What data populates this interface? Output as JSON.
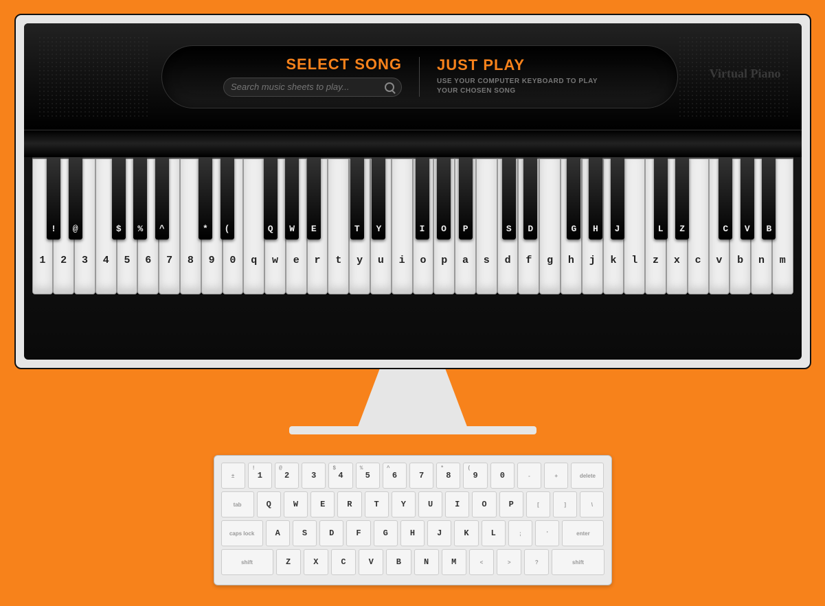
{
  "header": {
    "select_song": "SELECT SONG",
    "search_placeholder": "Search music sheets to play...",
    "just_play": "JUST PLAY",
    "sub1": "USE YOUR COMPUTER KEYBOARD TO PLAY",
    "sub2": "YOUR CHOSEN SONG",
    "logo": "Virtual Piano"
  },
  "white_keys": [
    "1",
    "2",
    "3",
    "4",
    "5",
    "6",
    "7",
    "8",
    "9",
    "0",
    "q",
    "w",
    "e",
    "r",
    "t",
    "y",
    "u",
    "i",
    "o",
    "p",
    "a",
    "s",
    "d",
    "f",
    "g",
    "h",
    "j",
    "k",
    "l",
    "z",
    "x",
    "c",
    "v",
    "b",
    "n",
    "m"
  ],
  "black_keys": [
    {
      "pos": 0,
      "label": "!"
    },
    {
      "pos": 1,
      "label": "@"
    },
    {
      "pos": 3,
      "label": "$"
    },
    {
      "pos": 4,
      "label": "%"
    },
    {
      "pos": 5,
      "label": "^"
    },
    {
      "pos": 7,
      "label": "*"
    },
    {
      "pos": 8,
      "label": "("
    },
    {
      "pos": 10,
      "label": "Q"
    },
    {
      "pos": 11,
      "label": "W"
    },
    {
      "pos": 12,
      "label": "E"
    },
    {
      "pos": 14,
      "label": "T"
    },
    {
      "pos": 15,
      "label": "Y"
    },
    {
      "pos": 17,
      "label": "I"
    },
    {
      "pos": 18,
      "label": "O"
    },
    {
      "pos": 19,
      "label": "P"
    },
    {
      "pos": 21,
      "label": "S"
    },
    {
      "pos": 22,
      "label": "D"
    },
    {
      "pos": 24,
      "label": "G"
    },
    {
      "pos": 25,
      "label": "H"
    },
    {
      "pos": 26,
      "label": "J"
    },
    {
      "pos": 28,
      "label": "L"
    },
    {
      "pos": 29,
      "label": "Z"
    },
    {
      "pos": 31,
      "label": "C"
    },
    {
      "pos": 32,
      "label": "V"
    },
    {
      "pos": 33,
      "label": "B"
    }
  ],
  "kbd": {
    "r1": [
      {
        "l": "±",
        "w": "kw1",
        "sm": 1
      },
      {
        "l": "1",
        "s": "!",
        "w": "kw1"
      },
      {
        "l": "2",
        "s": "@",
        "w": "kw1"
      },
      {
        "l": "3",
        "s": "",
        "w": "kw1"
      },
      {
        "l": "4",
        "s": "$",
        "w": "kw1"
      },
      {
        "l": "5",
        "s": "%",
        "w": "kw1"
      },
      {
        "l": "6",
        "s": "^",
        "w": "kw1"
      },
      {
        "l": "7",
        "s": "",
        "w": "kw1"
      },
      {
        "l": "8",
        "s": "*",
        "w": "kw1"
      },
      {
        "l": "9",
        "s": "(",
        "w": "kw1"
      },
      {
        "l": "0",
        "s": "",
        "w": "kw1"
      },
      {
        "l": "-",
        "w": "kw1",
        "sm": 1
      },
      {
        "l": "+",
        "w": "kw1",
        "sm": 1
      },
      {
        "l": "delete",
        "w": "kw15",
        "sm": 1
      }
    ],
    "r2": [
      {
        "l": "tab",
        "w": "kw15",
        "sm": 1
      },
      {
        "l": "Q",
        "w": "kw1"
      },
      {
        "l": "W",
        "w": "kw1"
      },
      {
        "l": "E",
        "w": "kw1"
      },
      {
        "l": "R",
        "w": "kw1"
      },
      {
        "l": "T",
        "w": "kw1"
      },
      {
        "l": "Y",
        "w": "kw1"
      },
      {
        "l": "U",
        "w": "kw1"
      },
      {
        "l": "I",
        "w": "kw1"
      },
      {
        "l": "O",
        "w": "kw1"
      },
      {
        "l": "P",
        "w": "kw1"
      },
      {
        "l": "[",
        "w": "kw1",
        "sm": 1
      },
      {
        "l": "]",
        "w": "kw1",
        "sm": 1
      },
      {
        "l": "\\",
        "w": "kw1",
        "sm": 1
      }
    ],
    "r3": [
      {
        "l": "caps lock",
        "w": "kw2",
        "sm": 1
      },
      {
        "l": "A",
        "w": "kw1"
      },
      {
        "l": "S",
        "w": "kw1"
      },
      {
        "l": "D",
        "w": "kw1"
      },
      {
        "l": "F",
        "w": "kw1"
      },
      {
        "l": "G",
        "w": "kw1"
      },
      {
        "l": "H",
        "w": "kw1"
      },
      {
        "l": "J",
        "w": "kw1"
      },
      {
        "l": "K",
        "w": "kw1"
      },
      {
        "l": "L",
        "w": "kw1"
      },
      {
        "l": ";",
        "w": "kw1",
        "sm": 1
      },
      {
        "l": "'",
        "w": "kw1",
        "sm": 1
      },
      {
        "l": "enter",
        "w": "kw2",
        "sm": 1
      }
    ],
    "r4": [
      {
        "l": "shift",
        "w": "kw25",
        "sm": 1
      },
      {
        "l": "Z",
        "w": "kw1"
      },
      {
        "l": "X",
        "w": "kw1"
      },
      {
        "l": "C",
        "w": "kw1"
      },
      {
        "l": "V",
        "w": "kw1"
      },
      {
        "l": "B",
        "w": "kw1"
      },
      {
        "l": "N",
        "w": "kw1"
      },
      {
        "l": "M",
        "w": "kw1"
      },
      {
        "l": "<",
        "w": "kw1",
        "sm": 1
      },
      {
        "l": ">",
        "w": "kw1",
        "sm": 1
      },
      {
        "l": "?",
        "w": "kw1",
        "sm": 1
      },
      {
        "l": "shift",
        "w": "kw25",
        "sm": 1
      }
    ]
  }
}
